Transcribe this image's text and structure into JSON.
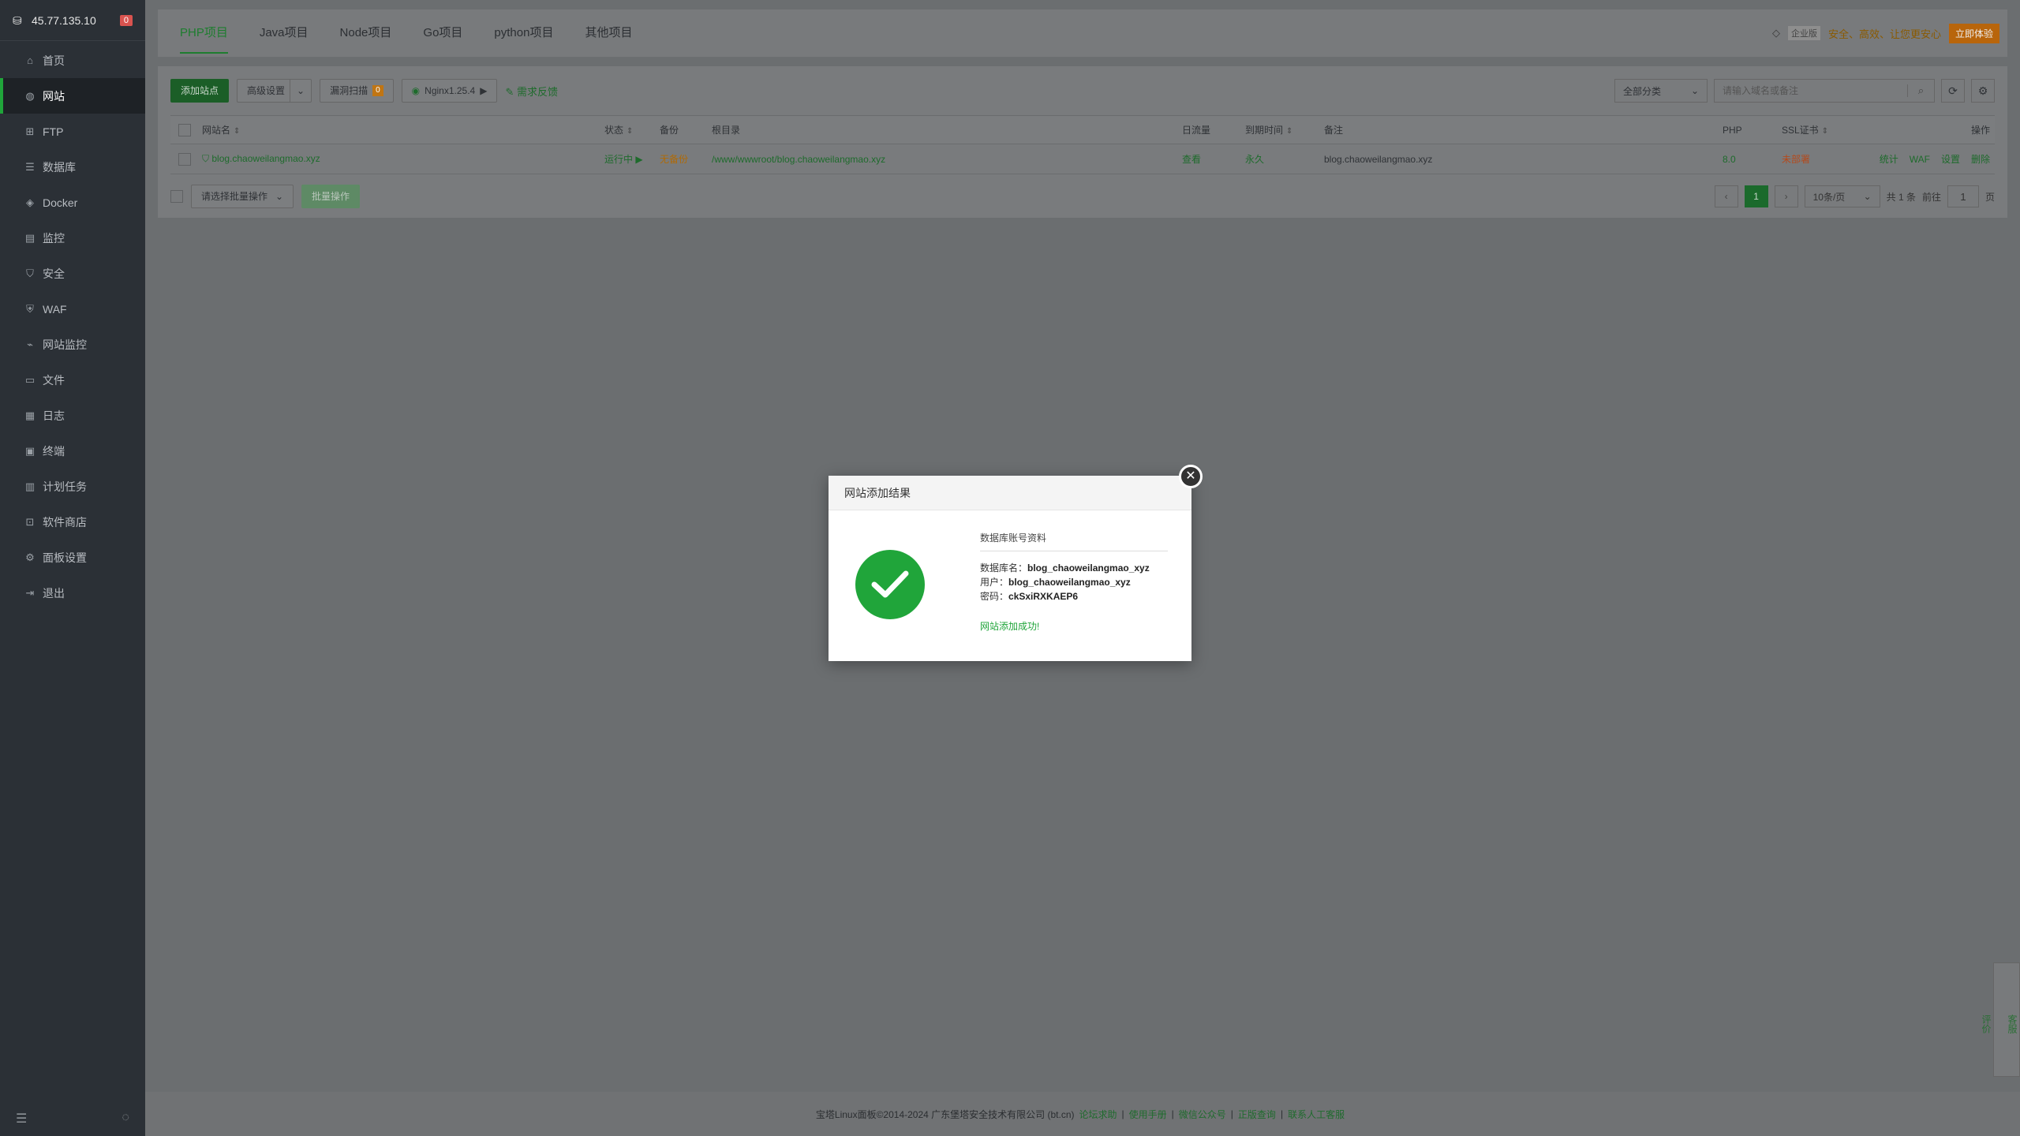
{
  "sidebar": {
    "ip": "45.77.135.10",
    "badge": "0",
    "items": [
      {
        "label": "首页",
        "icon": "home-icon"
      },
      {
        "label": "网站",
        "icon": "globe-icon"
      },
      {
        "label": "FTP",
        "icon": "ftp-icon"
      },
      {
        "label": "数据库",
        "icon": "database-icon"
      },
      {
        "label": "Docker",
        "icon": "docker-icon"
      },
      {
        "label": "监控",
        "icon": "monitor-icon"
      },
      {
        "label": "安全",
        "icon": "shield-icon"
      },
      {
        "label": "WAF",
        "icon": "waf-icon"
      },
      {
        "label": "网站监控",
        "icon": "chart-icon"
      },
      {
        "label": "文件",
        "icon": "folder-icon"
      },
      {
        "label": "日志",
        "icon": "log-icon"
      },
      {
        "label": "终端",
        "icon": "terminal-icon"
      },
      {
        "label": "计划任务",
        "icon": "clock-icon"
      },
      {
        "label": "软件商店",
        "icon": "store-icon"
      },
      {
        "label": "面板设置",
        "icon": "gear-icon"
      },
      {
        "label": "退出",
        "icon": "logout-icon"
      }
    ]
  },
  "tabs": [
    "PHP项目",
    "Java项目",
    "Node项目",
    "Go项目",
    "python项目",
    "其他项目"
  ],
  "topright": {
    "version": "企业版",
    "slogan": "安全、高效、让您更安心",
    "try": "立即体验"
  },
  "toolbar": {
    "add_site": "添加站点",
    "advanced": "高级设置",
    "vuln_scan": "漏洞扫描",
    "vuln_count": "0",
    "nginx": "Nginx1.25.4",
    "feedback": "需求反馈",
    "category": "全部分类",
    "search_placeholder": "请输入域名或备注"
  },
  "table": {
    "headers": [
      "网站名",
      "状态",
      "备份",
      "根目录",
      "日流量",
      "到期时间",
      "备注",
      "PHP",
      "SSL证书",
      "操作"
    ],
    "rows": [
      {
        "name": "blog.chaoweilangmao.xyz",
        "status": "运行中",
        "backup": "无备份",
        "root": "/www/wwwroot/blog.chaoweilangmao.xyz",
        "traffic": "查看",
        "expire": "永久",
        "remark": "blog.chaoweilangmao.xyz",
        "php": "8.0",
        "ssl": "未部署",
        "ops": [
          "统计",
          "WAF",
          "设置",
          "删除"
        ]
      }
    ]
  },
  "pager": {
    "batch_select": "请选择批量操作",
    "batch_btn": "批量操作",
    "current": "1",
    "page_size": "10条/页",
    "total": "共 1 条",
    "goto_label": "前往",
    "goto_value": "1",
    "page_unit": "页"
  },
  "footer": {
    "copyright": "宝塔Linux面板©2014-2024 广东堡塔安全技术有限公司 (bt.cn)",
    "links": [
      "论坛求助",
      "使用手册",
      "微信公众号",
      "正版查询",
      "联系人工客服"
    ]
  },
  "side_float": [
    "客服",
    "评价"
  ],
  "modal": {
    "title": "网站添加结果",
    "section_title": "数据库账号资料",
    "db_name_label": "数据库名：",
    "db_name": "blog_chaoweilangmao_xyz",
    "user_label": "用户：",
    "user": "blog_chaoweilangmao_xyz",
    "pass_label": "密码：",
    "pass": "ckSxiRXKAEP6",
    "success": "网站添加成功!"
  },
  "colors": {
    "brand_green": "#20a53a",
    "sidebar_bg": "#2b3036",
    "accent_orange": "#b8650b"
  }
}
